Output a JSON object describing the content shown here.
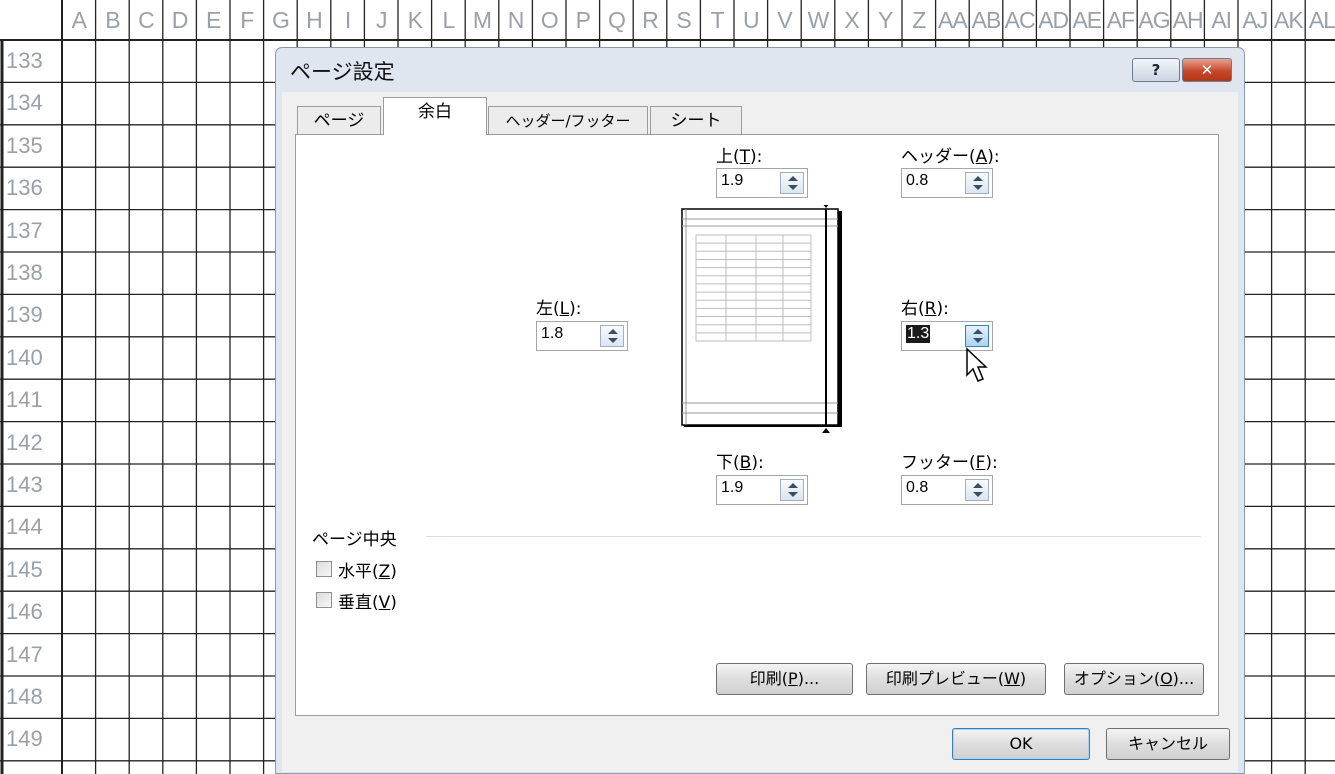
{
  "sheet": {
    "column_headers": [
      "A",
      "B",
      "C",
      "D",
      "E",
      "F",
      "G",
      "H",
      "I",
      "J",
      "K",
      "L",
      "M",
      "N",
      "O",
      "P",
      "Q",
      "R",
      "S",
      "T",
      "U",
      "V",
      "W",
      "X",
      "Y",
      "Z",
      "AA",
      "AB",
      "AC",
      "AD",
      "AE",
      "AF",
      "AG",
      "AH",
      "AI",
      "AJ",
      "AK",
      "AL"
    ],
    "row_headers": [
      "133",
      "134",
      "135",
      "136",
      "137",
      "138",
      "139",
      "140",
      "141",
      "142",
      "143",
      "144",
      "145",
      "146",
      "147",
      "148",
      "149"
    ]
  },
  "dialog": {
    "title": "ページ設定",
    "help_glyph": "?",
    "close_glyph": "✕",
    "tabs": [
      {
        "label": "ページ",
        "active": false
      },
      {
        "label": "余白",
        "active": true
      },
      {
        "label": "ヘッダー/フッター",
        "active": false
      },
      {
        "label": "シート",
        "active": false
      }
    ],
    "margins": {
      "top": {
        "label": "上",
        "key": "T",
        "value": "1.9"
      },
      "header": {
        "label": "ヘッダー",
        "key": "A",
        "value": "0.8"
      },
      "left": {
        "label": "左",
        "key": "L",
        "value": "1.8"
      },
      "right": {
        "label": "右",
        "key": "R",
        "value": "1.3"
      },
      "bottom": {
        "label": "下",
        "key": "B",
        "value": "1.9"
      },
      "footer": {
        "label": "フッター",
        "key": "F",
        "value": "0.8"
      }
    },
    "center": {
      "group_label": "ページ中央",
      "horizontal": {
        "label": "水平",
        "key": "Z",
        "checked": false
      },
      "vertical": {
        "label": "垂直",
        "key": "V",
        "checked": false
      }
    },
    "buttons": {
      "print": {
        "label": "印刷",
        "key": "P",
        "suffix": "..."
      },
      "preview": {
        "label": "印刷プレビュー",
        "key": "W",
        "suffix": ""
      },
      "options": {
        "label": "オプション",
        "key": "O",
        "suffix": "..."
      },
      "ok": "OK",
      "cancel": "キャンセル"
    }
  }
}
